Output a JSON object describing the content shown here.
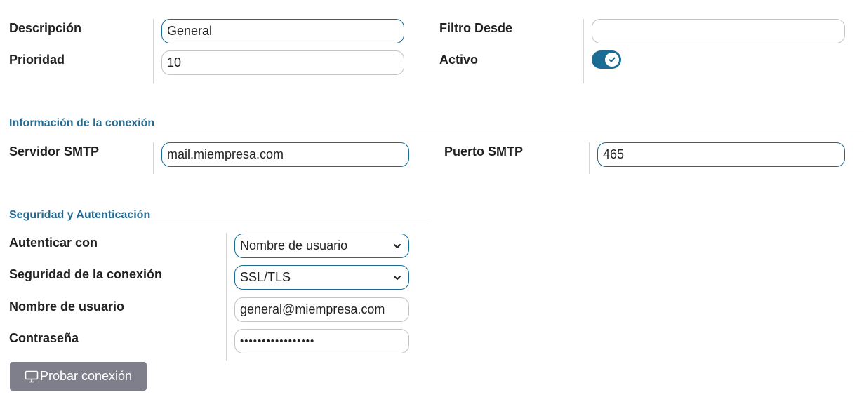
{
  "general": {
    "descripcion_label": "Descripción",
    "descripcion_value": "General",
    "prioridad_label": "Prioridad",
    "prioridad_value": "10",
    "filtro_label": "Filtro Desde",
    "filtro_value": "",
    "activo_label": "Activo",
    "activo_checked": true
  },
  "conexion": {
    "title": "Información de la conexión",
    "servidor_label": "Servidor SMTP",
    "servidor_value": "mail.miempresa.com",
    "puerto_label": "Puerto SMTP",
    "puerto_value": "465"
  },
  "seguridad": {
    "title": "Seguridad y Autenticación",
    "autenticar_label": "Autenticar con",
    "autenticar_value": "Nombre de usuario",
    "seguridad_label": "Seguridad de la conexión",
    "seguridad_value": "SSL/TLS",
    "usuario_label": "Nombre de usuario",
    "usuario_value": "general@miempresa.com",
    "contrasena_label": "Contraseña",
    "contrasena_value": "•••••••••••••••••"
  },
  "actions": {
    "probar_label": "Probar conexión"
  },
  "colors": {
    "accent": "#1a6c94",
    "section_title": "#246a93",
    "button_bg": "#7f7f8c"
  },
  "icons": {
    "check": "check-icon",
    "chevron": "chevron-down-icon",
    "monitor": "monitor-icon"
  }
}
